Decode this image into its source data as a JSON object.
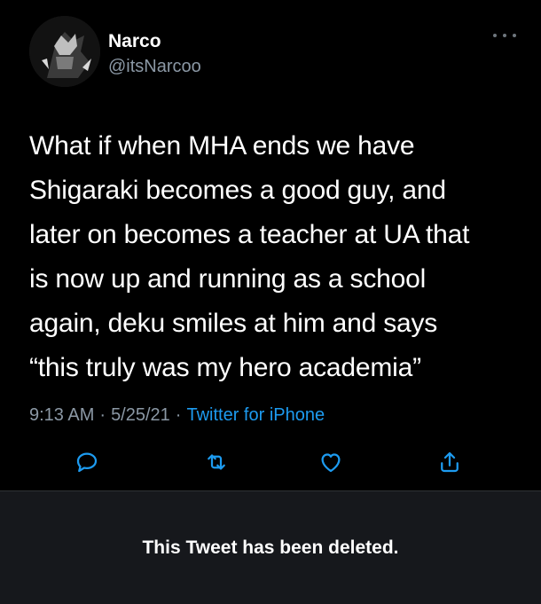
{
  "author": {
    "name": "Narco",
    "handle": "@itsNarcoo",
    "avatar_icon": "avatar-icon"
  },
  "tweet": {
    "lines": [
      "What if when MHA ends we have",
      "Shigaraki becomes a good guy, and",
      "later on becomes a teacher at UA that",
      "is now up and running as a school",
      "again, deku smiles at him and says",
      "“this truly was my hero academia”"
    ],
    "time": "9:13 AM",
    "date": "5/25/21",
    "separator": "·",
    "source": "Twitter for iPhone"
  },
  "actions": {
    "reply_icon": "reply-icon",
    "retweet_icon": "retweet-icon",
    "like_icon": "heart-icon",
    "share_icon": "share-icon"
  },
  "deleted_notice": {
    "text": "This Tweet has been deleted."
  },
  "colors": {
    "background": "#000000",
    "secondary_text": "#8b98a5",
    "link": "#1d9bf0",
    "icon": "#1d9bf0",
    "deleted_bg": "#16181c"
  }
}
